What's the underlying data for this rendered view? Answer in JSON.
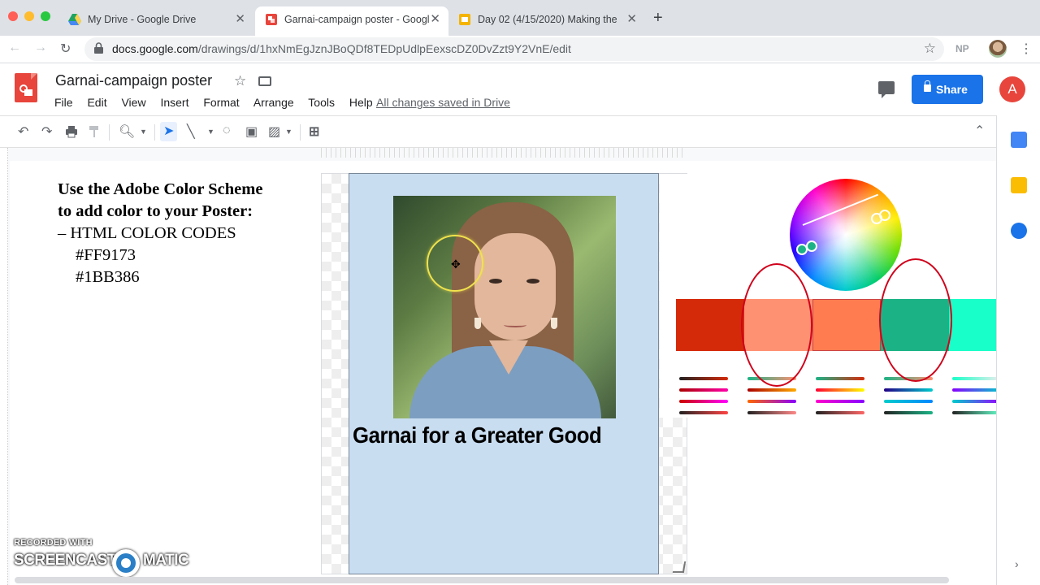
{
  "browser": {
    "tabs": [
      {
        "title": "My Drive - Google Drive",
        "icon": "google-drive-icon"
      },
      {
        "title": "Garnai-campaign poster - Googl",
        "icon": "google-drawings-icon",
        "active": true
      },
      {
        "title": "Day 02 (4/15/2020) Making the",
        "icon": "google-slides-icon"
      }
    ],
    "url_host": "docs.google.com",
    "url_path": "/drawings/d/1hxNmEgJznJBoQDf8TEDpUdlpEexscDZ0DvZzt9Y2VnE/edit",
    "extension_badge": "NP"
  },
  "doc": {
    "title": "Garnai-campaign poster",
    "menu": [
      "File",
      "Edit",
      "View",
      "Insert",
      "Format",
      "Arrange",
      "Tools",
      "Help"
    ],
    "save_status": "All changes saved in Drive",
    "share_label": "Share",
    "avatar_letter": "A"
  },
  "toolbar": {
    "icons": [
      "undo-icon",
      "redo-icon",
      "print-icon",
      "paint-format-icon",
      "zoom-icon",
      "select-icon",
      "line-icon",
      "shape-icon",
      "textbox-icon",
      "image-icon",
      "add-comment-icon"
    ]
  },
  "canvas": {
    "instructions": {
      "line1": "Use the Adobe Color Scheme",
      "line2": "to add color to your Poster:",
      "line3": "– HTML COLOR CODES",
      "code1": "#FF9173",
      "code2": "#1BB386"
    },
    "poster": {
      "background": "#c9ddf1",
      "headline": "Garnai for a Greater Good"
    }
  },
  "color_scheme": {
    "swatches": [
      "#D42A0A",
      "#FF9173",
      "#FF7C50",
      "#1BB386",
      "#19FFC9"
    ]
  },
  "watermark": {
    "recorded_with": "RECORDED WITH",
    "brand_left": "SCREENCAST",
    "brand_right": "MATIC"
  }
}
